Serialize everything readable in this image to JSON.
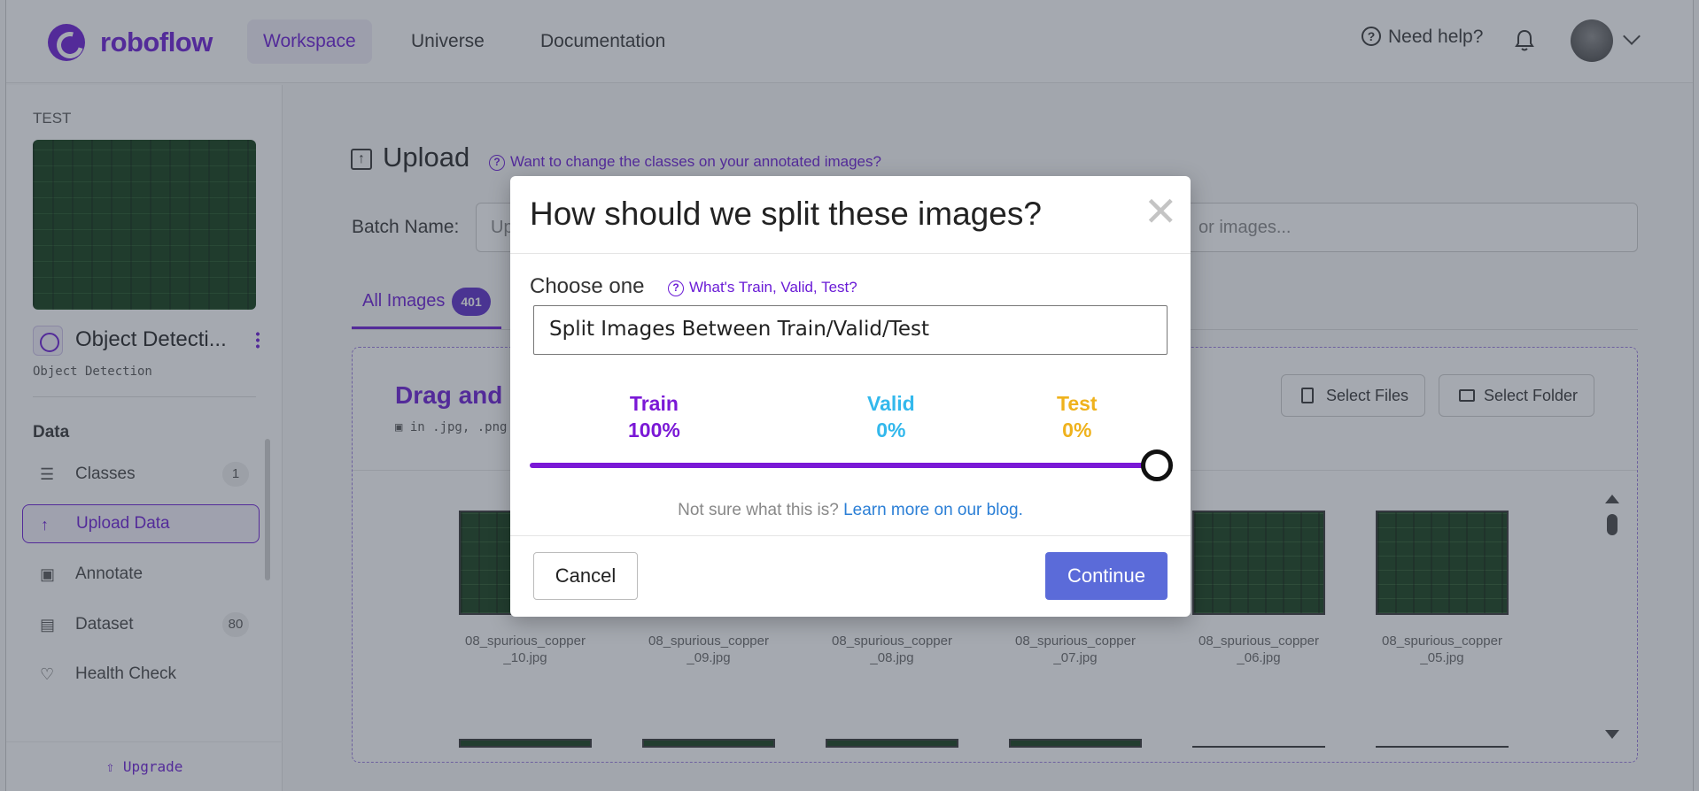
{
  "app": {
    "brand": "roboflow",
    "accent_color": "#6a1bd6"
  },
  "topnav": {
    "tabs": [
      {
        "label": "Workspace",
        "active": true
      },
      {
        "label": "Universe",
        "active": false
      },
      {
        "label": "Documentation",
        "active": false
      }
    ],
    "help_label": "Need help?",
    "icons": [
      "help-circle-icon",
      "bell-icon",
      "avatar",
      "chevron-down-icon"
    ]
  },
  "sidebar": {
    "workspace_label": "TEST",
    "project_name": "Object Detecti...",
    "project_type": "Object Detection",
    "section_title": "Data",
    "items": [
      {
        "label": "Classes",
        "badge": "1",
        "icon": "list-icon"
      },
      {
        "label": "Upload Data",
        "badge": "",
        "icon": "arrow-up-icon",
        "active": true
      },
      {
        "label": "Annotate",
        "badge": "",
        "icon": "annotate-icon"
      },
      {
        "label": "Dataset",
        "badge": "80",
        "icon": "images-icon"
      },
      {
        "label": "Health Check",
        "badge": "",
        "icon": "heart-pulse-icon"
      }
    ],
    "upgrade_label": "Upgrade"
  },
  "main": {
    "title": "Upload",
    "change_classes_link": "Want to change the classes on your annotated images?",
    "batch_label": "Batch Name:",
    "batch_value": "Up",
    "search_placeholder_tail": "or images...",
    "tab_all_label": "All Images",
    "tab_all_count": "401",
    "drop_title": "Drag and d",
    "drop_sub": "in .jpg, .png",
    "select_files": "Select Files",
    "select_folder": "Select Folder",
    "images": [
      {
        "name_line1": "08_spurious_copper",
        "name_line2": "_10.jpg"
      },
      {
        "name_line1": "08_spurious_copper",
        "name_line2": "_09.jpg"
      },
      {
        "name_line1": "08_spurious_copper",
        "name_line2": "_08.jpg"
      },
      {
        "name_line1": "08_spurious_copper",
        "name_line2": "_07.jpg"
      },
      {
        "name_line1": "08_spurious_copper",
        "name_line2": "_06.jpg"
      },
      {
        "name_line1": "08_spurious_copper",
        "name_line2": "_05.jpg"
      }
    ]
  },
  "modal": {
    "title": "How should we split these images?",
    "close_symbol": "✕",
    "choose_label": "Choose one",
    "whats_link": "What's Train, Valid, Test?",
    "selected_option": "Split Images Between Train/Valid/Test",
    "splits": [
      {
        "name": "Train",
        "percent": "100%",
        "color": "#7a18d6",
        "value": 100
      },
      {
        "name": "Valid",
        "percent": "0%",
        "color": "#33b8ec",
        "value": 0
      },
      {
        "name": "Test",
        "percent": "0%",
        "color": "#efb21d",
        "value": 0
      }
    ],
    "not_sure_text": "Not sure what this is?",
    "learn_more_link": "Learn more on our blog.",
    "cancel_label": "Cancel",
    "continue_label": "Continue",
    "continue_color": "#5b6bd9"
  }
}
